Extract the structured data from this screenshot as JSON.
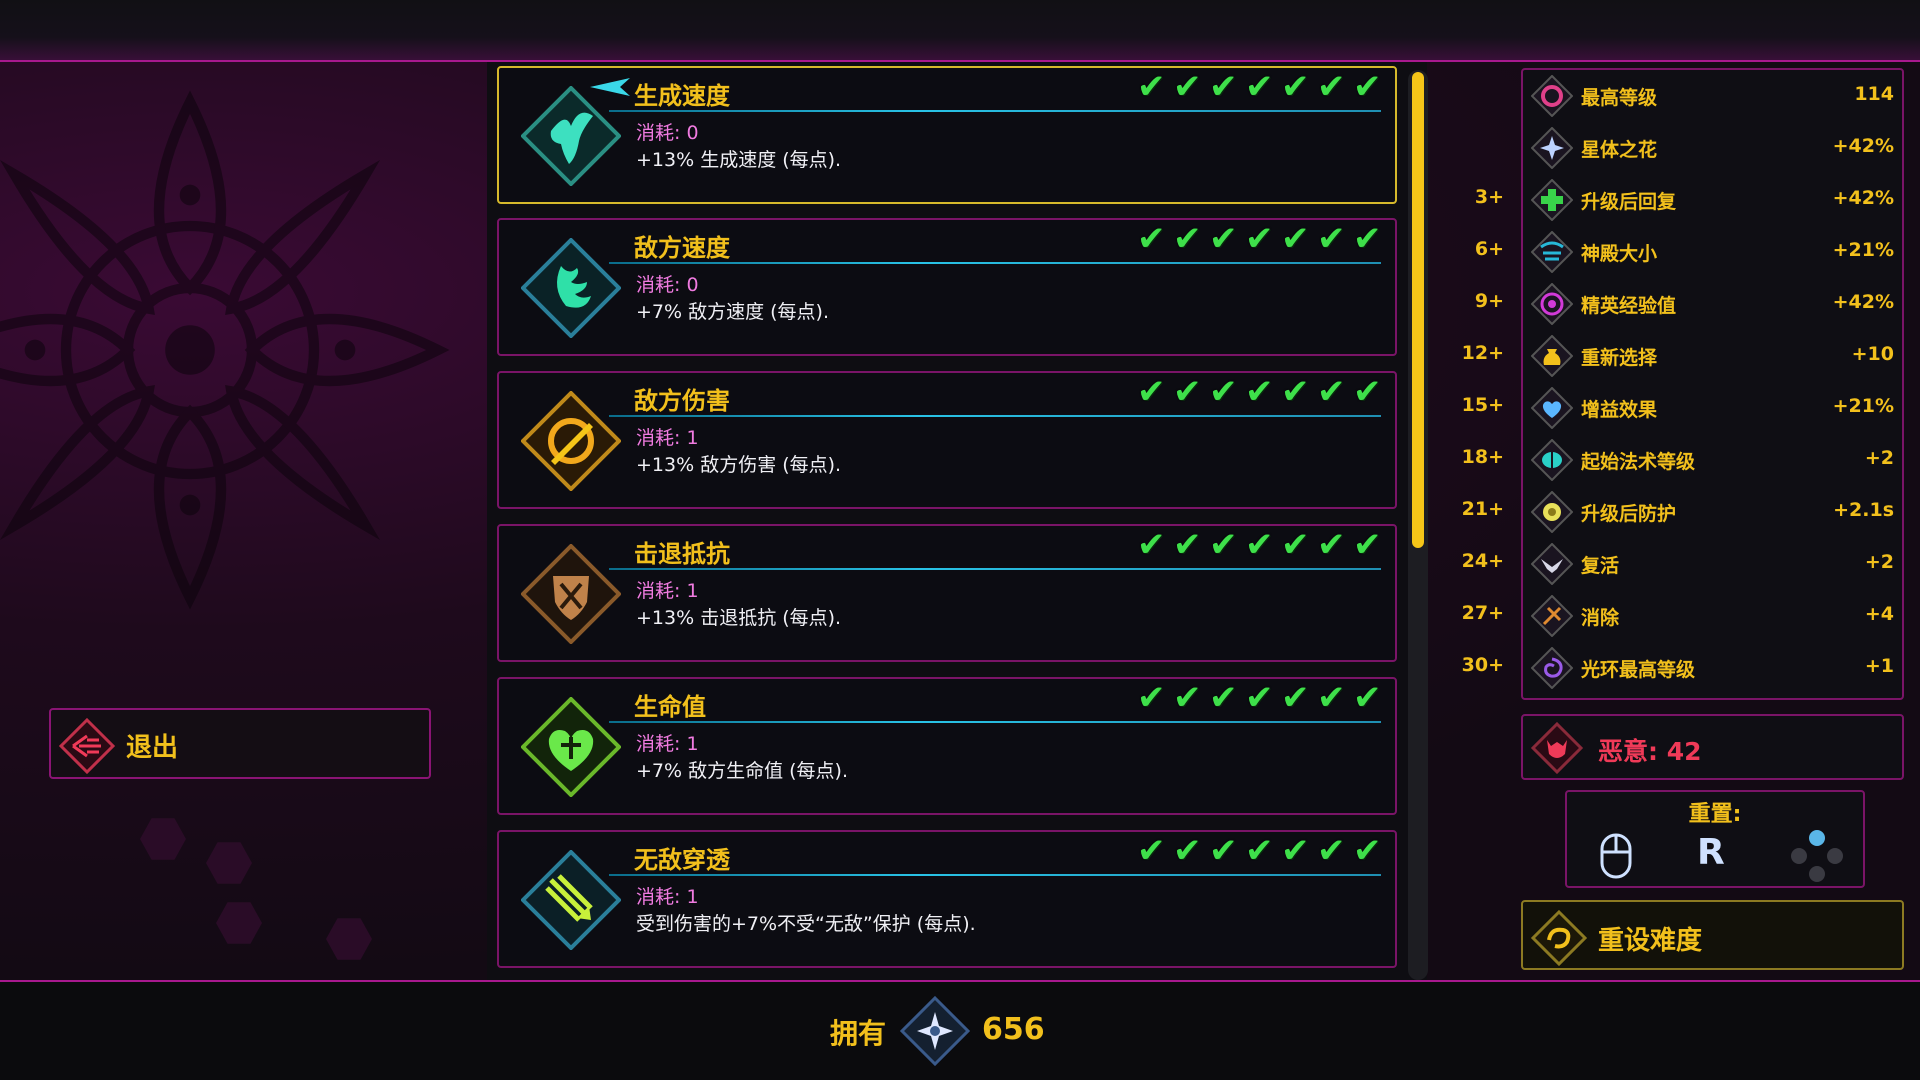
{
  "upgrades": [
    {
      "title": "生成速度",
      "cost": "消耗: 0",
      "desc": "+13% 生成速度 (每点).",
      "selected": true
    },
    {
      "title": "敌方速度",
      "cost": "消耗: 0",
      "desc": "+7% 敌方速度 (每点).",
      "selected": false
    },
    {
      "title": "敌方伤害",
      "cost": "消耗: 1",
      "desc": "+13% 敌方伤害 (每点).",
      "selected": false
    },
    {
      "title": "击退抵抗",
      "cost": "消耗: 1",
      "desc": "+13% 击退抵抗 (每点).",
      "selected": false
    },
    {
      "title": "生命值",
      "cost": "消耗: 1",
      "desc": "+7% 敌方生命值 (每点).",
      "selected": false
    },
    {
      "title": "无敌穿透",
      "cost": "消耗: 1",
      "desc": " 受到伤害的+7%不受“无敌”保护 (每点).",
      "selected": false
    }
  ],
  "checks_per_row": 7,
  "exit": {
    "label": "退出"
  },
  "stats": [
    {
      "req": "",
      "name": "最高等级",
      "value": "114",
      "icon": "swirl-icon",
      "color": "#e0408a"
    },
    {
      "req": "",
      "name": "星体之花",
      "value": "+42%",
      "icon": "flower-icon",
      "color": "#bcd2ff"
    },
    {
      "req": "3+",
      "name": "升级后回复",
      "value": "+42%",
      "icon": "heal-cross-icon",
      "color": "#39d24a"
    },
    {
      "req": "6+",
      "name": "神殿大小",
      "value": "+21%",
      "icon": "temple-icon",
      "color": "#27b8d8"
    },
    {
      "req": "9+",
      "name": "精英经验值",
      "value": "+42%",
      "icon": "elite-orb-icon",
      "color": "#d23ad8"
    },
    {
      "req": "12+",
      "name": "重新选择",
      "value": "+10",
      "icon": "reroll-bag-icon",
      "color": "#f2c01c"
    },
    {
      "req": "15+",
      "name": "增益效果",
      "value": "+21%",
      "icon": "heart-wings-icon",
      "color": "#5ab6ff"
    },
    {
      "req": "18+",
      "name": "起始法术等级",
      "value": "+2",
      "icon": "brain-icon",
      "color": "#2ad0c8"
    },
    {
      "req": "21+",
      "name": "升级后防护",
      "value": "+2.1s",
      "icon": "shield-flower-icon",
      "color": "#e8e05a"
    },
    {
      "req": "24+",
      "name": "复活",
      "value": "+2",
      "icon": "phoenix-icon",
      "color": "#d8d8e8"
    },
    {
      "req": "27+",
      "name": "消除",
      "value": "+4",
      "icon": "banish-icon",
      "color": "#e08a30"
    },
    {
      "req": "30+",
      "name": "光环最高等级",
      "value": "+1",
      "icon": "aura-icon",
      "color": "#9a5ae8"
    }
  ],
  "malice": {
    "label": "恶意: 42"
  },
  "reset": {
    "label": "重置:",
    "key": "R"
  },
  "reset_difficulty": {
    "label": "重设难度"
  },
  "owned": {
    "label": "拥有",
    "value": "656"
  },
  "colors": {
    "accent": "#f2c01c",
    "border": "#7a1467",
    "check": "#3ee04a",
    "cost": "#f07be0",
    "malice": "#f03a58"
  }
}
